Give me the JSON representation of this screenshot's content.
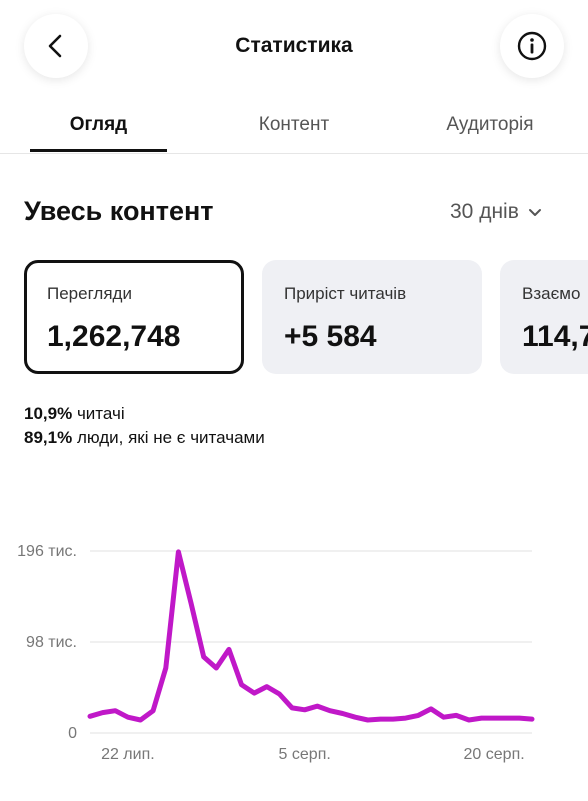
{
  "header": {
    "title": "Статистика",
    "back_icon": "chevron-left-icon",
    "info_icon": "info-icon"
  },
  "tabs": [
    {
      "label": "Огляд",
      "active": true
    },
    {
      "label": "Контент",
      "active": false
    },
    {
      "label": "Аудиторія",
      "active": false
    }
  ],
  "section": {
    "title": "Увесь контент",
    "period": "30 днів",
    "period_icon": "chevron-down-icon"
  },
  "metrics": [
    {
      "label": "Перегляди",
      "value": "1,262,748",
      "selected": true
    },
    {
      "label": "Приріст читачів",
      "value": "+5 584",
      "selected": false
    },
    {
      "label": "Взаємо",
      "value": "114,7",
      "selected": false
    }
  ],
  "breakdown": {
    "followers_pct": "10,9%",
    "followers_label": "читачі",
    "non_followers_pct": "89,1%",
    "non_followers_label": "люди, які не є читачами"
  },
  "chart_data": {
    "type": "line",
    "color": "#c018c8",
    "y_ticks": [
      "196 тис.",
      "98 тис.",
      "0"
    ],
    "ylim": [
      0,
      196000
    ],
    "x_ticks": [
      "22 лип.",
      "5 серп.",
      "20 серп."
    ],
    "x_tick_days": [
      3,
      17,
      32
    ],
    "grid": true,
    "series": [
      {
        "x": [
          0,
          1,
          2,
          3,
          4,
          5,
          6,
          7,
          8,
          9,
          10,
          11,
          12,
          13,
          14,
          15,
          16,
          17,
          18,
          19,
          20,
          21,
          22,
          23,
          24,
          25,
          26,
          27,
          28,
          29,
          30,
          31,
          32,
          33,
          34,
          35
        ],
        "values": [
          18000,
          22000,
          24000,
          17000,
          14000,
          24000,
          70000,
          195000,
          140000,
          82000,
          70000,
          90000,
          52000,
          43000,
          50000,
          42000,
          27000,
          25000,
          29000,
          24000,
          21000,
          17000,
          14000,
          15000,
          15000,
          16000,
          19000,
          26000,
          17000,
          19000,
          14000,
          16000,
          16000,
          16000,
          16000,
          15000
        ]
      }
    ]
  }
}
